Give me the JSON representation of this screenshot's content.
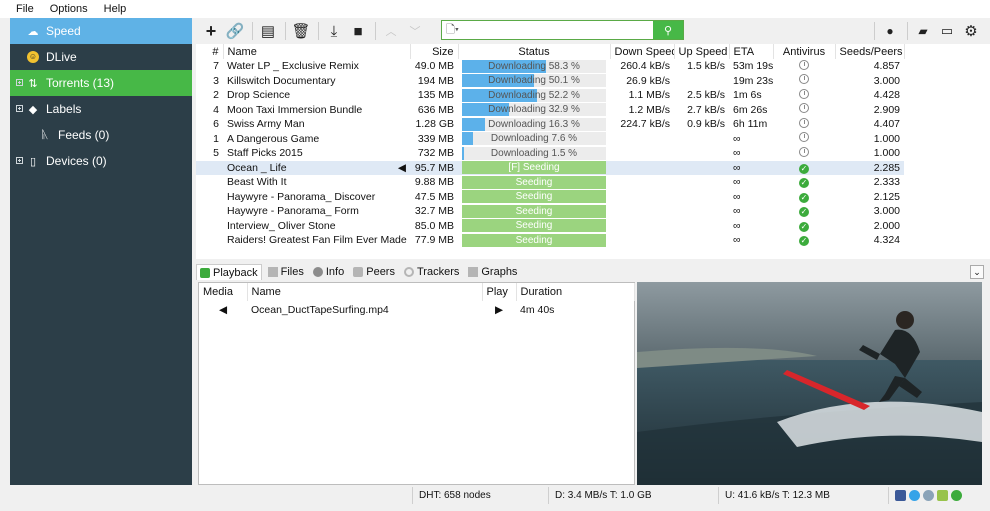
{
  "menu": [
    "File",
    "Options",
    "Help"
  ],
  "sidebar": {
    "items": [
      {
        "label": "Speed",
        "icon": "speed-icon"
      },
      {
        "label": "DLive",
        "icon": "dlive-icon"
      },
      {
        "label": "Torrents (13)",
        "icon": "torrents-icon"
      },
      {
        "label": "Labels",
        "icon": "tag-icon"
      },
      {
        "label": "Feeds (0)",
        "icon": "rss-icon"
      },
      {
        "label": "Devices (0)",
        "icon": "device-icon"
      }
    ]
  },
  "table": {
    "columns": [
      "#",
      "Name",
      "Size",
      "Status",
      "Down Speed",
      "Up Speed",
      "ETA",
      "Antivirus",
      "Seeds/Peers"
    ],
    "rows": [
      {
        "num": "7",
        "name": "Water LP _ Exclusive Remix",
        "size": "49.0 MB",
        "status": "Downloading 58.3 %",
        "progress": 0.583,
        "down": "260.4 kB/s",
        "up": "1.5 kB/s",
        "eta": "53m 19s",
        "av": "clock",
        "seeds": "4.857"
      },
      {
        "num": "3",
        "name": "Killswitch Documentary",
        "size": "194 MB",
        "status": "Downloading 50.1 %",
        "progress": 0.501,
        "down": "26.9 kB/s",
        "up": "",
        "eta": "19m 23s",
        "av": "clock",
        "seeds": "3.000"
      },
      {
        "num": "2",
        "name": "Drop Science",
        "size": "135 MB",
        "status": "Downloading 52.2 %",
        "progress": 0.522,
        "down": "1.1 MB/s",
        "up": "2.5 kB/s",
        "eta": "1m 6s",
        "av": "clock",
        "seeds": "4.428"
      },
      {
        "num": "4",
        "name": "Moon Taxi Immersion Bundle",
        "size": "636 MB",
        "status": "Downloading 32.9 %",
        "progress": 0.329,
        "down": "1.2 MB/s",
        "up": "2.7 kB/s",
        "eta": "6m 26s",
        "av": "clock",
        "seeds": "2.909"
      },
      {
        "num": "6",
        "name": "Swiss Army Man",
        "size": "1.28 GB",
        "status": "Downloading 16.3 %",
        "progress": 0.163,
        "down": "224.7 kB/s",
        "up": "0.9 kB/s",
        "eta": "6h 11m",
        "av": "clock",
        "seeds": "4.407"
      },
      {
        "num": "1",
        "name": "A Dangerous Game",
        "size": "339 MB",
        "status": "Downloading 7.6 %",
        "progress": 0.076,
        "down": "",
        "up": "",
        "eta": "∞",
        "av": "clock",
        "seeds": "1.000"
      },
      {
        "num": "5",
        "name": "Staff Picks 2015",
        "size": "732 MB",
        "status": "Downloading 1.5 %",
        "progress": 0.015,
        "down": "",
        "up": "",
        "eta": "∞",
        "av": "clock",
        "seeds": "1.000"
      },
      {
        "num": "",
        "name": "Ocean _ Life",
        "size": "95.7 MB",
        "status": "[F] Seeding",
        "progress": 1,
        "down": "",
        "up": "",
        "eta": "∞",
        "av": "ok",
        "seeds": "2.285",
        "selected": true
      },
      {
        "num": "",
        "name": "Beast With It",
        "size": "9.88 MB",
        "status": "Seeding",
        "progress": 1,
        "down": "",
        "up": "",
        "eta": "∞",
        "av": "ok",
        "seeds": "2.333"
      },
      {
        "num": "",
        "name": "Haywyre - Panorama_ Discover",
        "size": "47.5 MB",
        "status": "Seeding",
        "progress": 1,
        "down": "",
        "up": "",
        "eta": "∞",
        "av": "ok",
        "seeds": "2.125"
      },
      {
        "num": "",
        "name": "Haywyre - Panorama_ Form",
        "size": "32.7 MB",
        "status": "Seeding",
        "progress": 1,
        "down": "",
        "up": "",
        "eta": "∞",
        "av": "ok",
        "seeds": "3.000"
      },
      {
        "num": "",
        "name": "Interview_ Oliver Stone",
        "size": "85.0 MB",
        "status": "Seeding",
        "progress": 1,
        "down": "",
        "up": "",
        "eta": "∞",
        "av": "ok",
        "seeds": "2.000"
      },
      {
        "num": "",
        "name": "Raiders! Greatest Fan Film Ever Made",
        "size": "77.9 MB",
        "status": "Seeding",
        "progress": 1,
        "down": "",
        "up": "",
        "eta": "∞",
        "av": "ok",
        "seeds": "4.324"
      }
    ]
  },
  "tabs": [
    {
      "label": "Playback",
      "active": true
    },
    {
      "label": "Files"
    },
    {
      "label": "Info"
    },
    {
      "label": "Peers"
    },
    {
      "label": "Trackers"
    },
    {
      "label": "Graphs"
    }
  ],
  "media": {
    "columns": [
      "Media",
      "Name",
      "Play",
      "Duration"
    ],
    "rows": [
      {
        "name": "Ocean_DuctTapeSurfing.mp4",
        "duration": "4m 40s"
      }
    ]
  },
  "statusbar": {
    "dht": "DHT: 658 nodes",
    "down": "D: 3.4 MB/s T: 1.0 GB",
    "up": "U: 41.6 kB/s T: 12.3 MB"
  },
  "colors": {
    "accent_blue": "#5fb2e6",
    "accent_green": "#47b847",
    "sidebar_bg": "#2c3e48",
    "seeding": "#9bd47f"
  }
}
